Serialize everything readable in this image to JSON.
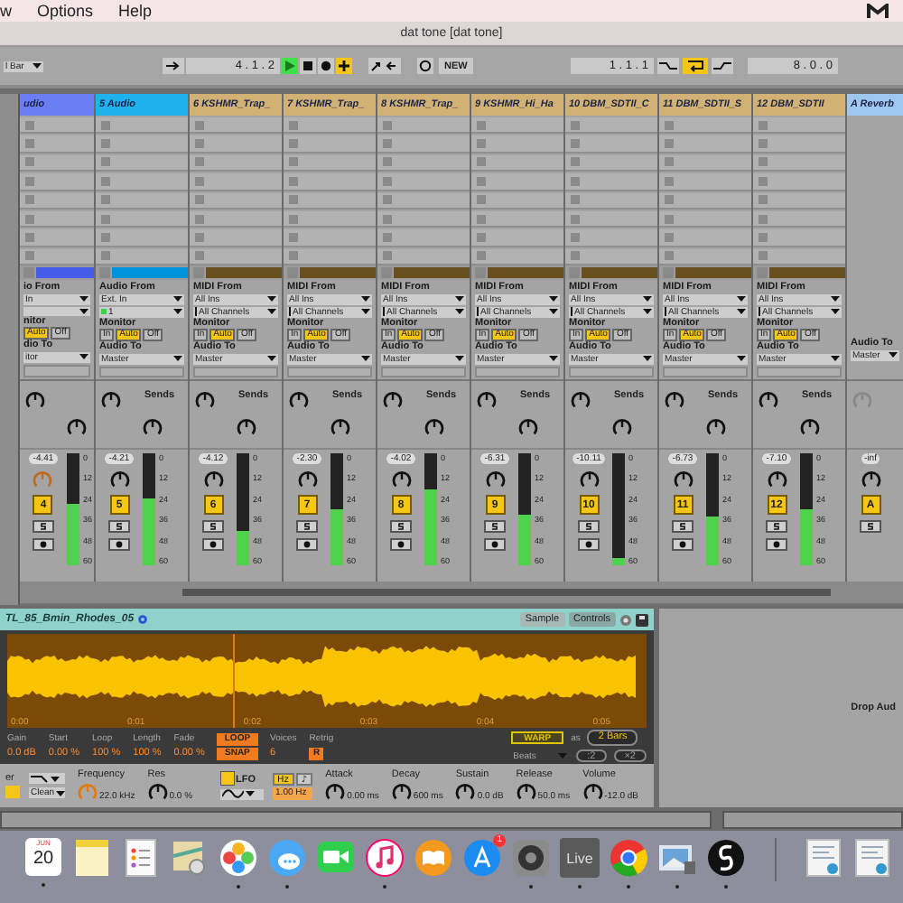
{
  "menu": {
    "items": [
      "w",
      "Options",
      "Help"
    ]
  },
  "window": {
    "title": "dat tone  [dat tone]"
  },
  "transport": {
    "quantize": "l Bar",
    "position": "4 .  1 .  2",
    "playing": true,
    "overdub": true,
    "new_label": "NEW",
    "loop_start": "1 .  1 .  1",
    "loop_on": true,
    "loop_length": "8 .  0 .  0"
  },
  "tracks": [
    {
      "kind": "audio",
      "name": "udio",
      "color": "#6b7df3",
      "clip_strip": true,
      "io": {
        "from_label": "io From",
        "from": "In",
        "monitor_label": "nitor",
        "monitor": [
          {
            "label": "Auto",
            "selected": true
          },
          {
            "label": "Off",
            "selected": false
          }
        ],
        "to_label": "dio To",
        "to": "itor"
      },
      "volume": "-4.41",
      "number": "4",
      "active": true,
      "level": 0.55,
      "scale": [
        "0",
        "12",
        "24",
        "36",
        "48",
        "60"
      ]
    },
    {
      "kind": "audio",
      "name": "5 Audio",
      "color": "#1fb2ef",
      "clip_strip": true,
      "io": {
        "from_label": "Audio From",
        "from": "Ext. In",
        "channel": "1",
        "monitor_label": "Monitor",
        "monitor": [
          {
            "label": "In",
            "selected": false
          },
          {
            "label": "Auto",
            "selected": true
          },
          {
            "label": "Off",
            "selected": false
          }
        ],
        "to_label": "Audio To",
        "to": "Master"
      },
      "sends_label": "Sends",
      "volume": "-4.21",
      "number": "5",
      "active": true,
      "level": 0.6,
      "scale": [
        "0",
        "12",
        "24",
        "36",
        "48",
        "60"
      ]
    },
    {
      "kind": "midi",
      "name": "6 KSHMR_Trap_",
      "color": "#d1b274",
      "clip_strip": true,
      "io": {
        "from_label": "MIDI From",
        "from": "All Ins",
        "channel": "All Channels",
        "monitor_label": "Monitor",
        "monitor": [
          {
            "label": "In",
            "selected": false
          },
          {
            "label": "Auto",
            "selected": true
          },
          {
            "label": "Off",
            "selected": false
          }
        ],
        "to_label": "Audio To",
        "to": "Master"
      },
      "sends_label": "Sends",
      "volume": "-4.12",
      "number": "6",
      "active": true,
      "level": 0.3,
      "scale": [
        "0",
        "12",
        "24",
        "36",
        "48",
        "60"
      ]
    },
    {
      "kind": "midi",
      "name": "7 KSHMR_Trap_",
      "color": "#d1b274",
      "clip_strip": true,
      "io": {
        "from_label": "MIDI From",
        "from": "All Ins",
        "channel": "All Channels",
        "monitor_label": "Monitor",
        "monitor": [
          {
            "label": "In",
            "selected": false
          },
          {
            "label": "Auto",
            "selected": true
          },
          {
            "label": "Off",
            "selected": false
          }
        ],
        "to_label": "Audio To",
        "to": "Master"
      },
      "sends_label": "Sends",
      "volume": "-2.30",
      "number": "7",
      "active": true,
      "level": 0.5,
      "scale": [
        "0",
        "12",
        "24",
        "36",
        "48",
        "60"
      ]
    },
    {
      "kind": "midi",
      "name": "8 KSHMR_Trap_",
      "color": "#d1b274",
      "clip_strip": true,
      "io": {
        "from_label": "MIDI From",
        "from": "All Ins",
        "channel": "All Channels",
        "monitor_label": "Monitor",
        "monitor": [
          {
            "label": "In",
            "selected": false
          },
          {
            "label": "Auto",
            "selected": true
          },
          {
            "label": "Off",
            "selected": false
          }
        ],
        "to_label": "Audio To",
        "to": "Master"
      },
      "sends_label": "Sends",
      "volume": "-4.02",
      "number": "8",
      "active": true,
      "level": 0.68,
      "scale": [
        "0",
        "12",
        "24",
        "36",
        "48",
        "60"
      ]
    },
    {
      "kind": "midi",
      "name": "9 KSHMR_Hi_Ha",
      "color": "#d1b274",
      "clip_strip": true,
      "io": {
        "from_label": "MIDI From",
        "from": "All Ins",
        "channel": "All Channels",
        "monitor_label": "Monitor",
        "monitor": [
          {
            "label": "In",
            "selected": false
          },
          {
            "label": "Auto",
            "selected": true
          },
          {
            "label": "Off",
            "selected": false
          }
        ],
        "to_label": "Audio To",
        "to": "Master"
      },
      "sends_label": "Sends",
      "volume": "-6.31",
      "number": "9",
      "active": true,
      "level": 0.45,
      "scale": [
        "0",
        "12",
        "24",
        "36",
        "48",
        "60"
      ]
    },
    {
      "kind": "midi",
      "name": "10 DBM_SDTII_C",
      "color": "#d1b274",
      "clip_strip": true,
      "io": {
        "from_label": "MIDI From",
        "from": "All Ins",
        "channel": "All Channels",
        "monitor_label": "Monitor",
        "monitor": [
          {
            "label": "In",
            "selected": false
          },
          {
            "label": "Auto",
            "selected": true
          },
          {
            "label": "Off",
            "selected": false
          }
        ],
        "to_label": "Audio To",
        "to": "Master"
      },
      "sends_label": "Sends",
      "volume": "-10.11",
      "number": "10",
      "active": true,
      "level": 0.06,
      "scale": [
        "0",
        "12",
        "24",
        "36",
        "48",
        "60"
      ]
    },
    {
      "kind": "midi",
      "name": "11 DBM_SDTII_S",
      "color": "#d1b274",
      "clip_strip": true,
      "io": {
        "from_label": "MIDI From",
        "from": "All Ins",
        "channel": "All Channels",
        "monitor_label": "Monitor",
        "monitor": [
          {
            "label": "In",
            "selected": false
          },
          {
            "label": "Auto",
            "selected": true
          },
          {
            "label": "Off",
            "selected": false
          }
        ],
        "to_label": "Audio To",
        "to": "Master"
      },
      "sends_label": "Sends",
      "volume": "-6.73",
      "number": "11",
      "active": true,
      "level": 0.43,
      "scale": [
        "0",
        "12",
        "24",
        "36",
        "48",
        "60"
      ]
    },
    {
      "kind": "midi",
      "name": "12 DBM_SDTII",
      "color": "#d1b274",
      "clip_strip": true,
      "io": {
        "from_label": "MIDI From",
        "from": "All Ins",
        "channel": "All Channels",
        "monitor_label": "Monitor",
        "monitor": [
          {
            "label": "In",
            "selected": false
          },
          {
            "label": "Auto",
            "selected": true
          },
          {
            "label": "Off",
            "selected": false
          }
        ],
        "to_label": "Audio To",
        "to": "Master"
      },
      "sends_label": "Sends",
      "volume": "-7.10",
      "number": "12",
      "active": true,
      "level": 0.5,
      "scale": [
        "0",
        "12",
        "24",
        "36",
        "48",
        "60"
      ]
    },
    {
      "kind": "return",
      "name": "A Reverb",
      "color": "#9ec8f0",
      "io": {
        "to_label": "Audio To",
        "to": "Master"
      },
      "volume": "-inf",
      "number": "A",
      "active": true
    }
  ],
  "clip": {
    "name": "TL_85_Bmin_Rhodes_05",
    "tabs": [
      {
        "label": "Sample",
        "selected": true
      },
      {
        "label": "Controls",
        "selected": false
      }
    ],
    "time_labels": [
      "0:00",
      "0:01",
      "0:02",
      "0:03",
      "0:04",
      "0:05"
    ],
    "params": [
      {
        "label": "Gain",
        "value": "0.0 dB"
      },
      {
        "label": "Start",
        "value": "0.00 %"
      },
      {
        "label": "Loop",
        "value": "100 %"
      },
      {
        "label": "Length",
        "value": "100 %"
      },
      {
        "label": "Fade",
        "value": "0.00 %"
      }
    ],
    "loop": {
      "label": "LOOP",
      "on": true
    },
    "snap": {
      "label": "SNAP",
      "on": true
    },
    "voices": {
      "label": "Voices",
      "value": "6"
    },
    "retrig": {
      "label": "Retrig",
      "value": "R",
      "on": true
    },
    "warp": {
      "label": "WARP",
      "on": true
    },
    "as": "as",
    "bars": "2 Bars",
    "mode": "Beats",
    "half": ":2",
    "double": "×2"
  },
  "synth": {
    "filter_label": "er",
    "filter_type": "Clean",
    "frequency": {
      "label": "Frequency",
      "value": "22.0 kHz"
    },
    "res": {
      "label": "Res",
      "value": "0.0 %"
    },
    "lfo": {
      "label": "LFO",
      "on": true
    },
    "units": [
      {
        "label": "Hz",
        "selected": true
      },
      {
        "label": "♪",
        "selected": false
      }
    ],
    "rate": "1.00 Hz",
    "envelope": [
      {
        "label": "Attack",
        "value": "0.00 ms"
      },
      {
        "label": "Decay",
        "value": "600 ms"
      },
      {
        "label": "Sustain",
        "value": "0.0 dB"
      },
      {
        "label": "Release",
        "value": "50.0 ms"
      },
      {
        "label": "Volume",
        "value": "-12.0 dB"
      }
    ]
  },
  "drop": {
    "text": "Drop Aud"
  },
  "dock": [
    {
      "kind": "calendar",
      "month": "JUN",
      "day": "20",
      "running": true
    },
    {
      "kind": "notes",
      "running": false
    },
    {
      "kind": "reminders",
      "running": false
    },
    {
      "kind": "preview",
      "running": false
    },
    {
      "kind": "photos",
      "running": true
    },
    {
      "kind": "messages",
      "running": true
    },
    {
      "kind": "facetime",
      "running": false
    },
    {
      "kind": "music",
      "running": true
    },
    {
      "kind": "books",
      "running": false
    },
    {
      "kind": "store",
      "badge": "1",
      "running": false
    },
    {
      "kind": "settings",
      "running": true
    },
    {
      "kind": "live",
      "label": "Live",
      "running": true
    },
    {
      "kind": "browser",
      "running": true
    },
    {
      "kind": "photo",
      "running": true
    },
    {
      "kind": "swirl",
      "running": true
    },
    {
      "kind": "separator",
      "running": false
    },
    {
      "kind": "document",
      "running": false
    },
    {
      "kind": "document",
      "running": false
    }
  ]
}
